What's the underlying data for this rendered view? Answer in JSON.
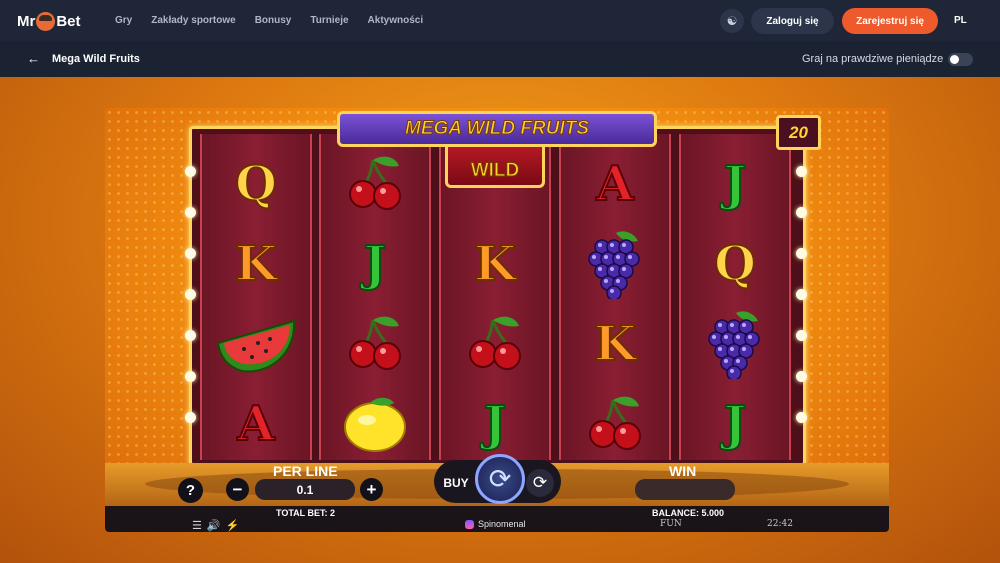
{
  "header": {
    "logo_left": "Mr",
    "logo_right": "Bet",
    "nav": [
      "Gry",
      "Zakłady sportowe",
      "Bonusy",
      "Turnieje",
      "Aktywności"
    ],
    "login": "Zaloguj się",
    "register": "Zarejestruj się",
    "language": "PL",
    "accent_color": "#ee5a2c"
  },
  "gamebar": {
    "back_icon": "arrow-left-icon",
    "title": "Mega Wild Fruits",
    "real_money_label": "Graj na prawdziwe pieniądze",
    "real_money_on": false
  },
  "game": {
    "banner": "MEGA WILD FRUITS",
    "lines": "20",
    "reels": [
      [
        "Q",
        "K",
        "watermelon",
        "A"
      ],
      [
        "cherries",
        "J",
        "cherries",
        "lemon"
      ],
      [
        "wild",
        "K",
        "cherries",
        "J"
      ],
      [
        "A",
        "grapes",
        "K",
        "cherries"
      ],
      [
        "J",
        "Q",
        "grapes",
        "J"
      ]
    ],
    "wild_label": "WILD",
    "per_line_label": "PER LINE",
    "bet_value": "0.1",
    "buy_label": "BUY",
    "win_label": "WIN",
    "total_bet": "TOTAL BET: 2",
    "balance": "BALANCE: 5.000",
    "provider": "Spinomenal",
    "mode": "FUN",
    "clock": "22:42",
    "help": "?",
    "minus": "−",
    "plus": "+"
  }
}
